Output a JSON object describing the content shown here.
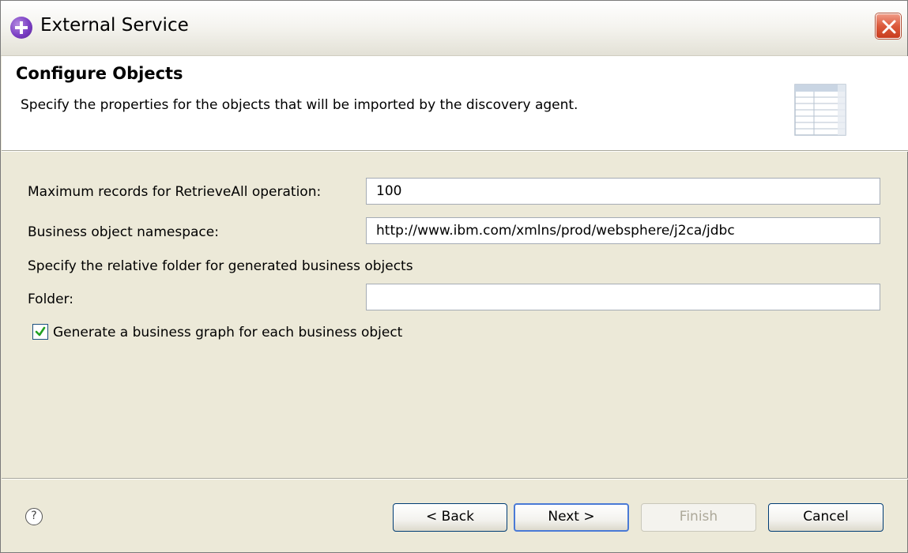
{
  "window": {
    "title": "External Service"
  },
  "header": {
    "title": "Configure Objects",
    "description": "Specify the properties for the objects that will be imported by the discovery agent."
  },
  "form": {
    "max_records_label": "Maximum records for RetrieveAll operation:",
    "max_records_value": "100",
    "namespace_label": "Business object namespace:",
    "namespace_value": "http://www.ibm.com/xmlns/prod/websphere/j2ca/jdbc",
    "folder_hint": "Specify the relative folder for generated business objects",
    "folder_label": "Folder:",
    "folder_value": "",
    "business_graph_label": "Generate a business graph for each business object",
    "business_graph_checked": true
  },
  "footer": {
    "help_symbol": "?",
    "back_label": "< Back",
    "next_label": "Next >",
    "finish_label": "Finish",
    "cancel_label": "Cancel"
  },
  "colors": {
    "accent": "#4a7ad6",
    "close": "#dc5a3c",
    "check": "#21a121"
  }
}
